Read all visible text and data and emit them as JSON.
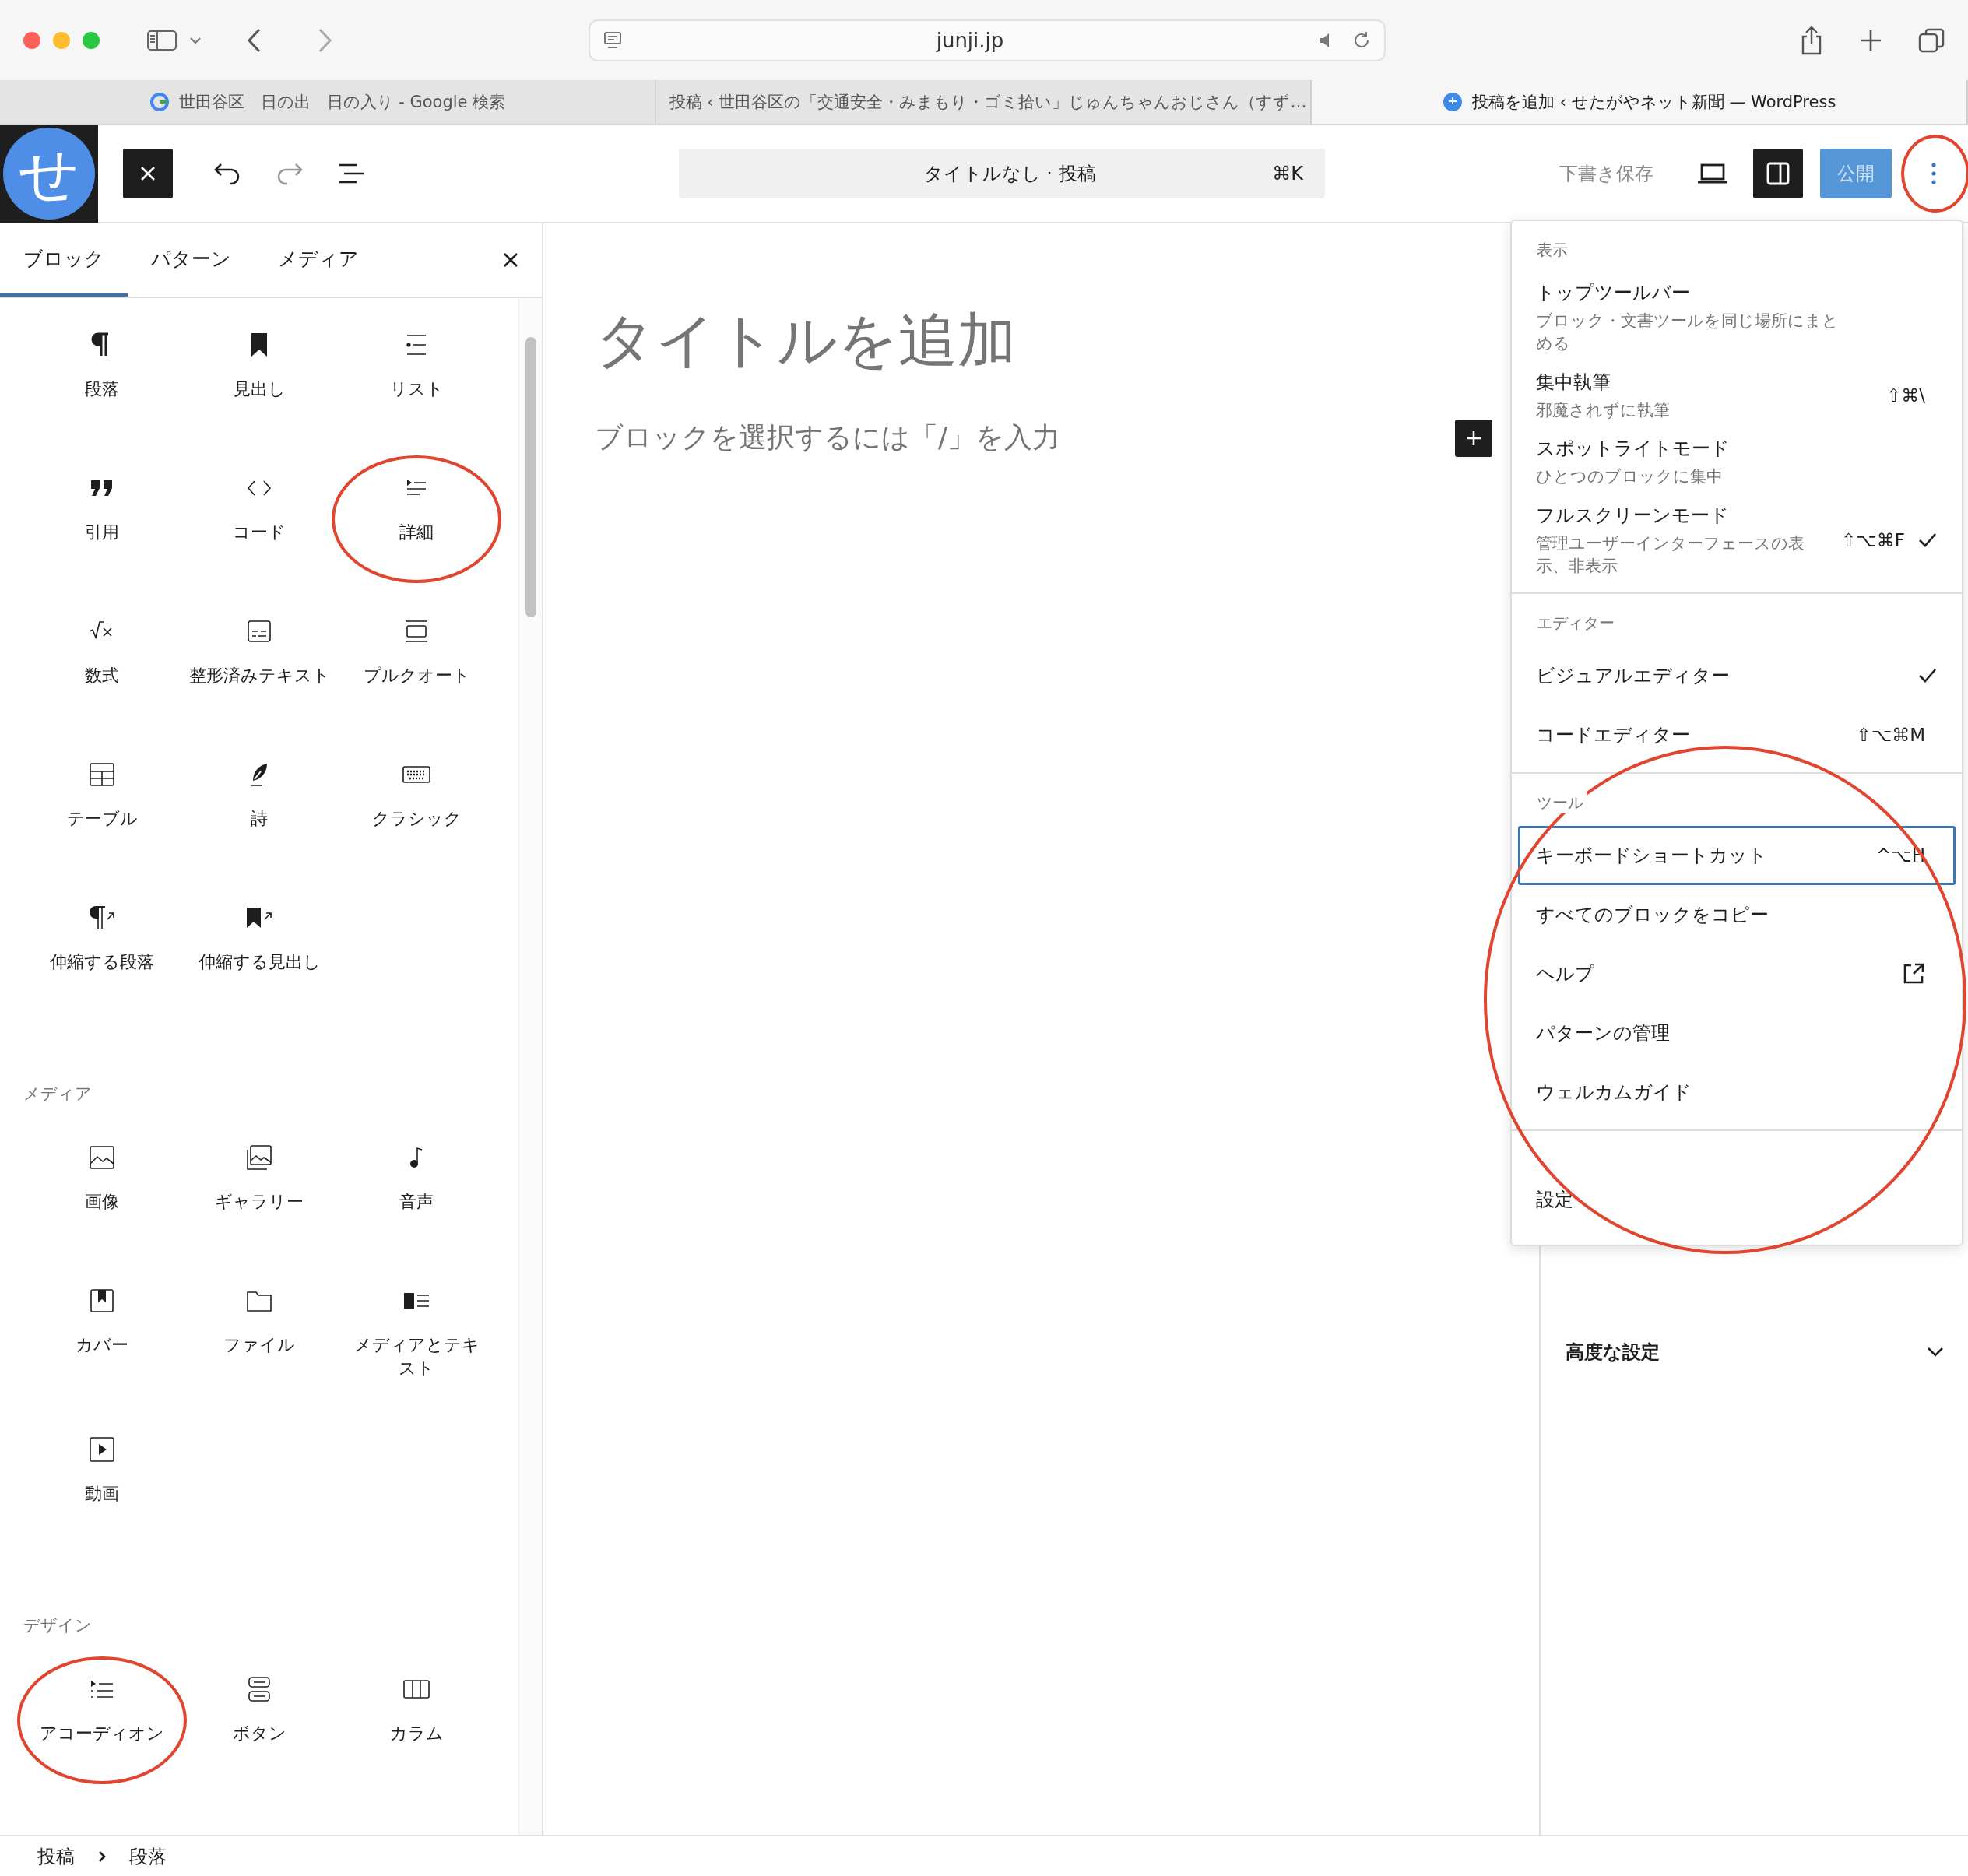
{
  "browser": {
    "address": "junji.jp",
    "tabs": [
      {
        "title": "世田谷区　日の出　日の入り - Google 検索",
        "kind": "google",
        "selected": false
      },
      {
        "title": "投稿 ‹ 世田谷区の「交通安全・みまもり・ゴミ拾い」じゅんちゃんおじさん（すず…",
        "kind": "badge",
        "selected": false
      },
      {
        "title": "投稿を追加 ‹ せたがやネット新聞 — WordPress",
        "kind": "site",
        "selected": true
      }
    ]
  },
  "header": {
    "site_logo": "せ",
    "command_bar": {
      "title": "タイトルなし · 投稿",
      "shortcut": "⌘K"
    },
    "save_draft": "下書き保存",
    "publish": "公開",
    "sidebar_open": true,
    "more_circled": true
  },
  "inserter": {
    "tabs": [
      {
        "label": "ブロック",
        "selected": true
      },
      {
        "label": "パターン",
        "selected": false
      },
      {
        "label": "メディア",
        "selected": false
      }
    ],
    "sections": [
      {
        "blocks": [
          {
            "label": "段落",
            "kind": "paragraph",
            "circled": false
          },
          {
            "label": "見出し",
            "kind": "heading",
            "circled": false
          },
          {
            "label": "リスト",
            "kind": "list",
            "circled": false
          },
          {
            "label": "引用",
            "kind": "quote",
            "circled": false
          },
          {
            "label": "コード",
            "kind": "code",
            "circled": false
          },
          {
            "label": "詳細",
            "kind": "details",
            "circled": true
          },
          {
            "label": "数式",
            "kind": "math",
            "circled": false
          },
          {
            "label": "整形済みテキスト",
            "kind": "preformatted",
            "circled": false
          },
          {
            "label": "プルクオート",
            "kind": "pullquote",
            "circled": false
          },
          {
            "label": "テーブル",
            "kind": "table",
            "circled": false
          },
          {
            "label": "詩",
            "kind": "verse",
            "circled": false
          },
          {
            "label": "クラシック",
            "kind": "classic",
            "circled": false
          },
          {
            "label": "伸縮する段落",
            "kind": "stretchy-paragraph",
            "circled": false
          },
          {
            "label": "伸縮する見出し",
            "kind": "stretchy-heading",
            "circled": false
          }
        ]
      },
      {
        "heading": "メディア",
        "blocks": [
          {
            "label": "画像",
            "kind": "image",
            "circled": false
          },
          {
            "label": "ギャラリー",
            "kind": "gallery",
            "circled": false
          },
          {
            "label": "音声",
            "kind": "audio",
            "circled": false
          },
          {
            "label": "カバー",
            "kind": "cover",
            "circled": false
          },
          {
            "label": "ファイル",
            "kind": "file",
            "circled": false
          },
          {
            "label": "メディアとテキスト",
            "kind": "media-text",
            "circled": false
          },
          {
            "label": "動画",
            "kind": "video",
            "circled": false
          }
        ]
      },
      {
        "heading": "デザイン",
        "blocks": [
          {
            "label": "アコーディオン",
            "kind": "accordion",
            "circled": true
          },
          {
            "label": "ボタン",
            "kind": "buttons",
            "circled": false
          },
          {
            "label": "カラム",
            "kind": "columns",
            "circled": false
          }
        ]
      }
    ]
  },
  "editor": {
    "title_placeholder": "タイトルを追加",
    "body_placeholder": "ブロックを選択するには「/」を入力"
  },
  "settings_sidebar": {
    "row": "高度な設定"
  },
  "options_menu": {
    "sections": [
      {
        "heading": "表示",
        "circled": false,
        "items": [
          {
            "label": "トップツールバー",
            "description": "ブロック・文書ツールを同じ場所にまとめる",
            "checked": false,
            "focused": false
          },
          {
            "label": "集中執筆",
            "description": "邪魔されずに執筆",
            "shortcut": "⇧⌘\\",
            "checked": false,
            "focused": false
          },
          {
            "label": "スポットライトモード",
            "description": "ひとつのブロックに集中",
            "checked": false,
            "focused": false
          },
          {
            "label": "フルスクリーンモード",
            "description": "管理ユーザーインターフェースの表示、非表示",
            "shortcut": "⇧⌥⌘F",
            "checked": true,
            "focused": false
          }
        ]
      },
      {
        "heading": "エディター",
        "circled": false,
        "items": [
          {
            "label": "ビジュアルエディター",
            "checked": true,
            "focused": false
          },
          {
            "label": "コードエディター",
            "shortcut": "⇧⌥⌘M",
            "checked": false,
            "focused": false
          }
        ]
      },
      {
        "heading": "ツール",
        "circled": true,
        "items": [
          {
            "label": "キーボードショートカット",
            "shortcut": "^⌥H",
            "checked": false,
            "focused": true
          },
          {
            "label": "すべてのブロックをコピー",
            "checked": false,
            "focused": false
          },
          {
            "label": "ヘルプ",
            "external": true,
            "checked": false,
            "focused": false
          },
          {
            "label": "パターンの管理",
            "checked": false,
            "focused": false
          },
          {
            "label": "ウェルカムガイド",
            "checked": false,
            "focused": false
          }
        ]
      },
      {
        "circled": false,
        "items": [
          {
            "label": "設定",
            "checked": false,
            "focused": false
          }
        ]
      }
    ]
  },
  "breadcrumb": [
    "投稿",
    "段落"
  ]
}
